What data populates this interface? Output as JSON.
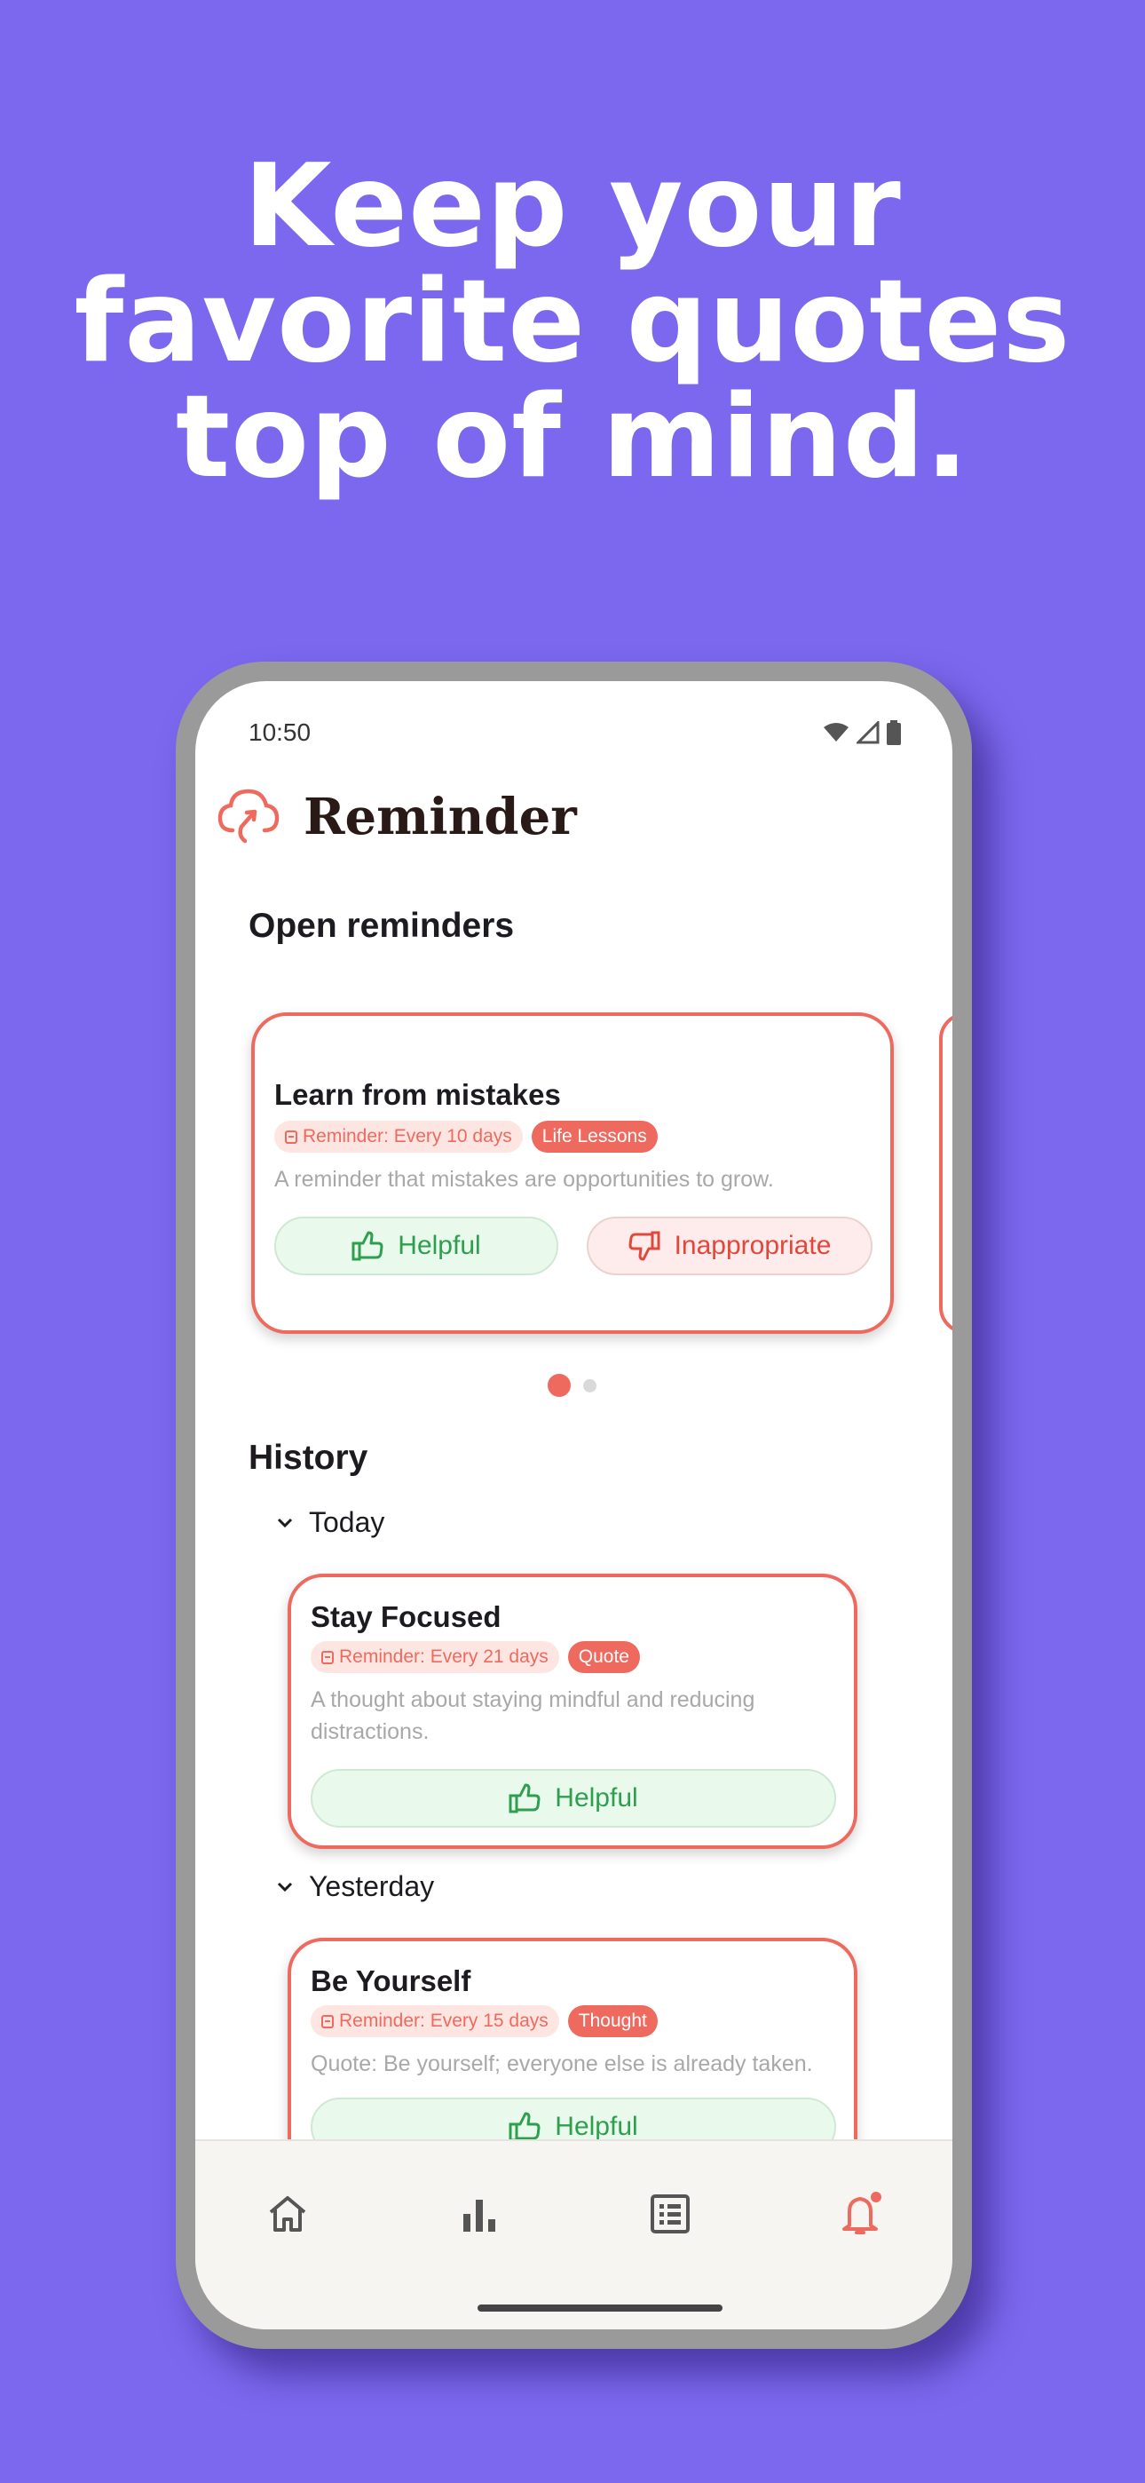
{
  "headline": {
    "line1": "Keep your",
    "line2": "favorite quotes",
    "line3": "top of mind."
  },
  "status_bar": {
    "time": "10:50",
    "icons": [
      "wifi-icon",
      "signal-icon",
      "battery-icon"
    ]
  },
  "app": {
    "title": "Reminder",
    "logo_icon": "cloud-arrow-icon",
    "accent_color": "#ee6a5e",
    "helpful_color": "#2e9e4f",
    "inappropriate_color": "#e2473b"
  },
  "open_reminders": {
    "title": "Open reminders",
    "cards": [
      {
        "title": "Learn from mistakes",
        "reminder": "Reminder: Every 10 days",
        "tag": "Life Lessons",
        "description": "A reminder that mistakes are opportunities to grow.",
        "helpful_label": "Helpful",
        "inappropriate_label": "Inappropriate"
      }
    ],
    "pager": {
      "current": 1,
      "total": 2
    }
  },
  "history": {
    "title": "History",
    "groups": [
      {
        "label": "Today",
        "cards": [
          {
            "title": "Stay Focused",
            "reminder": "Reminder: Every 21 days",
            "tag": "Quote",
            "description_line1": "A thought about staying mindful and reducing",
            "description_line2": "distractions.",
            "helpful_label": "Helpful"
          }
        ]
      },
      {
        "label": "Yesterday",
        "cards": [
          {
            "title": "Be Yourself",
            "reminder": "Reminder: Every 15 days",
            "tag": "Thought",
            "description": "Quote: Be yourself; everyone else is already taken.",
            "helpful_label": "Helpful"
          }
        ]
      }
    ]
  },
  "nav": {
    "items": [
      {
        "icon": "home-icon",
        "active": false
      },
      {
        "icon": "bar-chart-icon",
        "active": false
      },
      {
        "icon": "list-icon",
        "active": false
      },
      {
        "icon": "bell-icon",
        "active": true,
        "badge": true
      }
    ]
  }
}
